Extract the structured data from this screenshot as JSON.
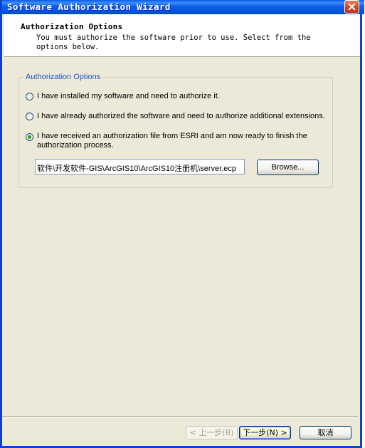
{
  "window": {
    "title": "Software Authorization Wizard",
    "close_icon": "close-icon"
  },
  "header": {
    "title": "Authorization Options",
    "description": "You must authorize the software prior to use. Select from the options below."
  },
  "group": {
    "label": "Authorization Options",
    "options": [
      {
        "label": "I have installed my software and need to authorize it.",
        "selected": false
      },
      {
        "label": "I have already authorized the software and need to authorize additional extensions.",
        "selected": false
      },
      {
        "label": "I have received an authorization file from ESRI and am now ready to finish the authorization process.",
        "selected": true
      }
    ],
    "file_path": "软件\\开发软件-GIS\\ArcGIS10\\ArcGIS10注册机\\server.ecp",
    "browse_label": "Browse..."
  },
  "footer": {
    "back_label": "< 上一步(B)",
    "next_label": "下一步(N) >",
    "cancel_label": "取消"
  },
  "colors": {
    "titlebar": "#0b5ee8",
    "dialog_bg": "#ece9d8",
    "group_label": "#1f55c8",
    "radio_selected": "#21a121"
  }
}
